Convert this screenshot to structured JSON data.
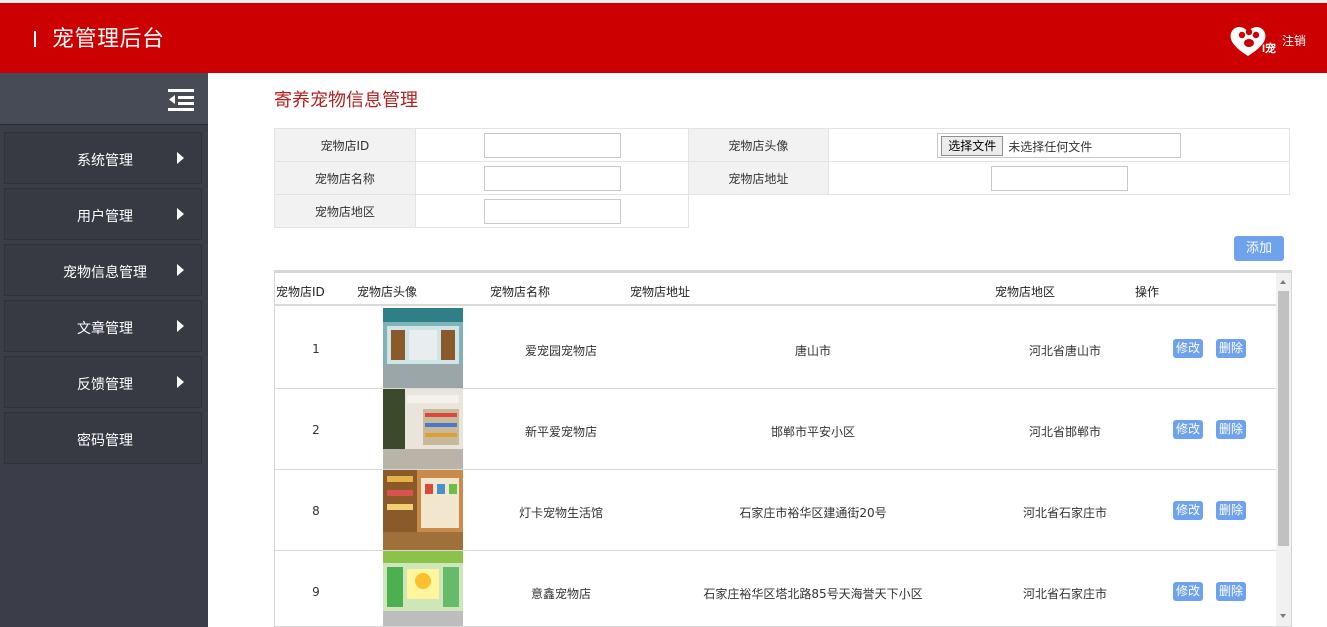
{
  "header": {
    "title": "宠管理后台",
    "logout_label": "注销",
    "logo_text": "I宠"
  },
  "sidebar": {
    "items": [
      {
        "label": "系统管理",
        "arrow": true
      },
      {
        "label": "用户管理",
        "arrow": true
      },
      {
        "label": "宠物信息管理",
        "arrow": true
      },
      {
        "label": "文章管理",
        "arrow": true
      },
      {
        "label": "反馈管理",
        "arrow": true
      },
      {
        "label": "密码管理",
        "arrow": false
      }
    ]
  },
  "page": {
    "title": "寄养宠物信息管理"
  },
  "form": {
    "id_label": "宠物店ID",
    "id_value": "",
    "avatar_label": "宠物店头像",
    "file_button": "选择文件",
    "file_status": "未选择任何文件",
    "name_label": "宠物店名称",
    "name_value": "",
    "address_label": "宠物店地址",
    "address_value": "",
    "region_label": "宠物店地区",
    "region_value": "",
    "add_button": "添加"
  },
  "table": {
    "headers": [
      "宠物店ID",
      "宠物店头像",
      "宠物店名称",
      "宠物店地址",
      "宠物店地区",
      "操作"
    ],
    "edit_label": "修改",
    "delete_label": "删除",
    "rows": [
      {
        "id": "1",
        "name": "爱宠园宠物店",
        "address": "唐山市",
        "region": "河北省唐山市",
        "thumb": "store-front"
      },
      {
        "id": "2",
        "name": "新平爱宠物店",
        "address": "邯郸市平安小区",
        "region": "河北省邯郸市",
        "thumb": "store-interior"
      },
      {
        "id": "8",
        "name": "灯卡宠物生活馆",
        "address": "石家庄市裕华区建通街20号",
        "region": "河北省石家庄市",
        "thumb": "store-shelves"
      },
      {
        "id": "9",
        "name": "意鑫宠物店",
        "address": "石家庄裕华区塔北路85号天海誉天下小区",
        "region": "河北省石家庄市",
        "thumb": "store-green"
      }
    ]
  },
  "colors": {
    "header_bg": "#cc0000",
    "sidebar_bg": "#3b3e48",
    "accent_button": "#6ea1ee",
    "title_red": "#b22222"
  }
}
